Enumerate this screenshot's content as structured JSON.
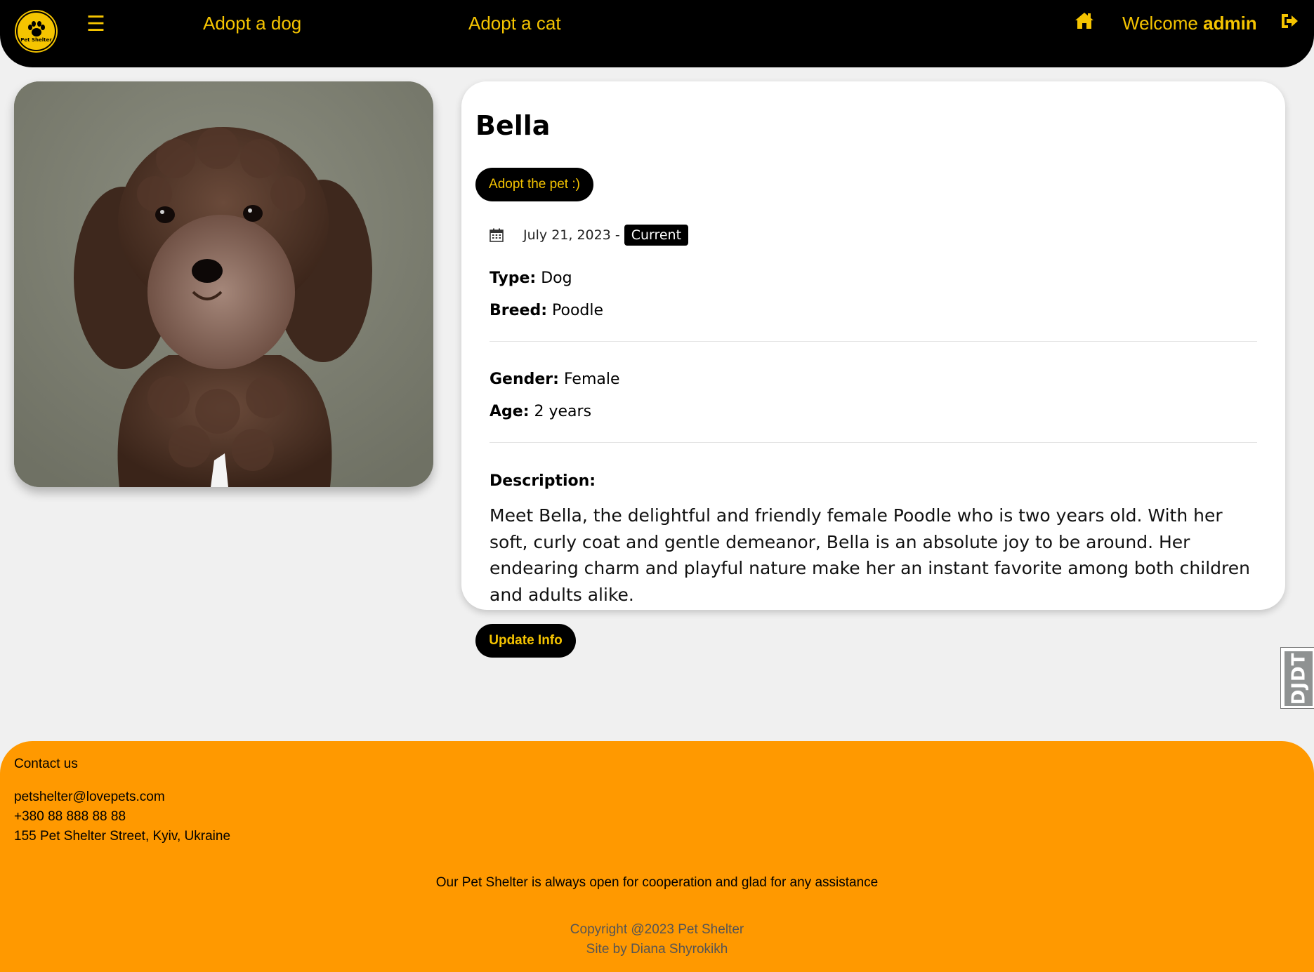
{
  "header": {
    "logo_text": "Pet Shelter",
    "menu_icon": "☰",
    "nav": [
      {
        "label": "Adopt a dog"
      },
      {
        "label": "Adopt a cat"
      }
    ],
    "welcome_prefix": "Welcome",
    "username": "admin",
    "icons": [
      "home-icon",
      "logout-icon"
    ],
    "accent_color": "#f5c400",
    "background_color": "#000000"
  },
  "pet": {
    "name": "Bella",
    "adopt_label": "Adopt the pet :)",
    "date": "July 21, 2023",
    "date_separator": "-",
    "status": "Current",
    "type_label": "Type:",
    "type": "Dog",
    "breed_label": "Breed:",
    "breed": "Poodle",
    "gender_label": "Gender:",
    "gender": "Female",
    "age_label": "Age:",
    "age": "2 years",
    "description_label": "Description:",
    "description": "Meet Bella, the delightful and friendly female Poodle who is two years old. With her soft, curly coat and gentle demeanor, Bella is an absolute joy to be around. Her endearing charm and playful nature make her an instant favorite among both children and adults alike."
  },
  "actions": {
    "update_label": "Update Info"
  },
  "side_widget": {
    "label": "DJDT"
  },
  "footer": {
    "contact_title": "Contact us",
    "email": "petshelter@lovepets.com",
    "phone": "+380 88 888 88 88",
    "address": "155 Pet Shelter Street, Kyiv, Ukraine",
    "tagline": "Our Pet Shelter is always open for cooperation and glad for any assistance",
    "copyright": "Copyright @2023 Pet Shelter",
    "credits": "Site by Diana Shyrokikh",
    "background_color": "#ff9900"
  }
}
